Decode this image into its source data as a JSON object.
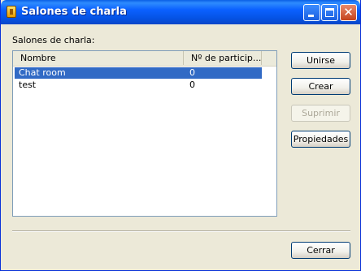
{
  "window": {
    "title": "Salones de charla"
  },
  "group_label": "Salones de charla:",
  "list": {
    "columns": [
      "Nombre",
      "Nº de particip..."
    ],
    "rows": [
      {
        "name": "Chat room",
        "count": "0",
        "selected": true
      },
      {
        "name": "test",
        "count": "0",
        "selected": false
      }
    ]
  },
  "buttons": {
    "join": "Unirse",
    "create": "Crear",
    "delete": "Suprimir",
    "properties": "Propiedades",
    "close": "Cerrar"
  },
  "colors": {
    "titlebar": "#0553e4",
    "selection": "#316ac5",
    "dialog": "#ece9d8"
  },
  "icons": {
    "window": "app-icon",
    "minimize": "minimize-icon",
    "maximize": "maximize-icon",
    "close": "close-icon"
  }
}
